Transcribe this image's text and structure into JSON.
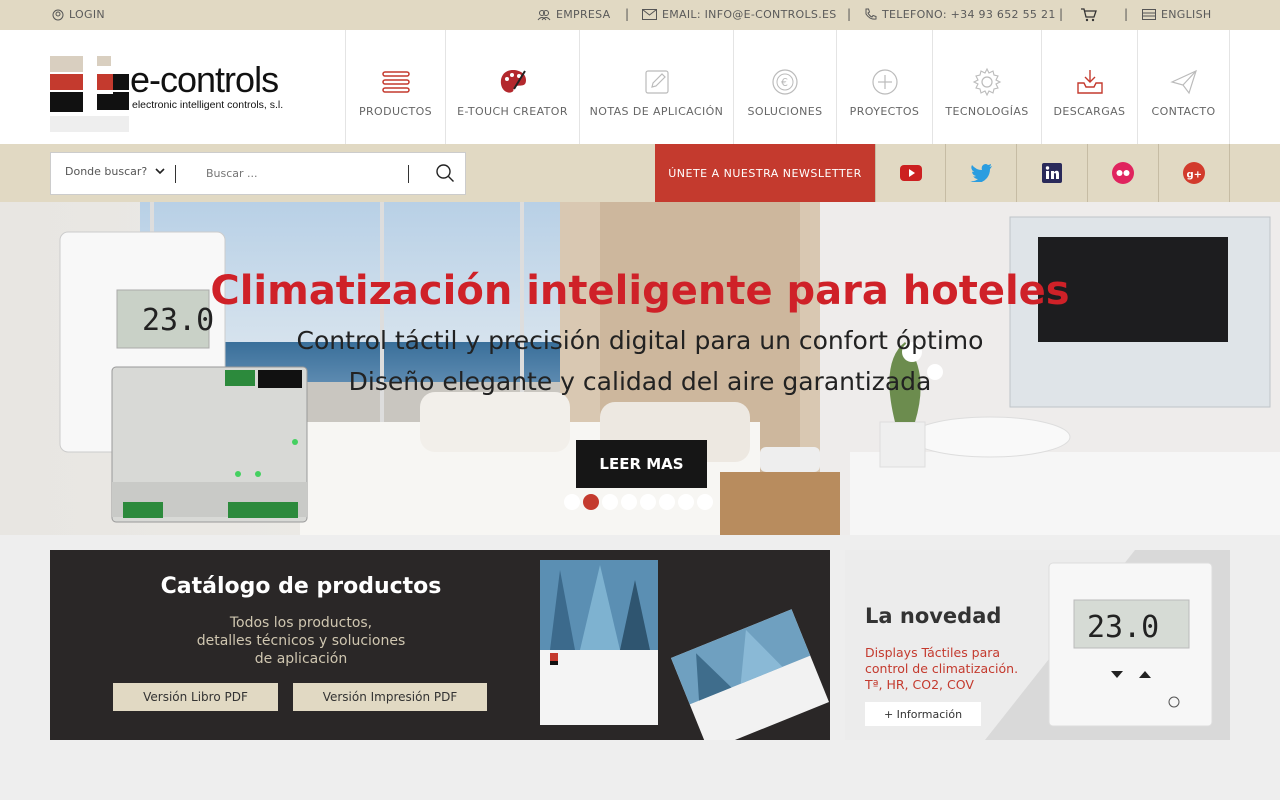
{
  "topbar": {
    "login": "LOGIN",
    "empresa": "EMPRESA",
    "email": "EMAIL: INFO@E-CONTROLS.ES",
    "telefono": "TELEFONO: +34 93 652 55 21",
    "language": "ENGLISH"
  },
  "logo": {
    "brand": "e-controls",
    "tagline": "electronic intelligent controls, s.l."
  },
  "nav": [
    {
      "label": "PRODUCTOS",
      "icon": "menu-lines-icon"
    },
    {
      "label": "E-TOUCH CREATOR",
      "icon": "palette-icon"
    },
    {
      "label": "NOTAS DE APLICACIÓN",
      "icon": "pencil-note-icon"
    },
    {
      "label": "SOLUCIONES",
      "icon": "euro-coin-icon"
    },
    {
      "label": "PROYECTOS",
      "icon": "plus-circle-icon"
    },
    {
      "label": "TECNOLOGÍAS",
      "icon": "gear-icon"
    },
    {
      "label": "DESCARGAS",
      "icon": "download-tray-icon"
    },
    {
      "label": "CONTACTO",
      "icon": "paper-plane-icon"
    }
  ],
  "search": {
    "select_value": "Donde buscar?",
    "placeholder": "Buscar ..."
  },
  "newsletter": "ÚNETE A NUESTRA NEWSLETTER",
  "hero": {
    "title": "Climatización inteligente para hoteles",
    "line1": "Control táctil y precisión digital para un confort óptimo",
    "line2": "Diseño elegante y calidad del aire garantizada",
    "button": "LEER MAS",
    "device_temp": "23.0"
  },
  "catalog": {
    "title": "Catálogo de productos",
    "desc1": "Todos los productos,",
    "desc2": "detalles técnicos y soluciones",
    "desc3": "de aplicación",
    "btn_libro": "Versión Libro PDF",
    "btn_impresion": "Versión Impresión PDF"
  },
  "novedad": {
    "title": "La novedad",
    "desc1": "Displays Táctiles para",
    "desc2": "control de climatización.",
    "desc3": "Tª, HR, CO2, COV",
    "button": "+ Información",
    "device_temp": "23.0"
  },
  "colors": {
    "accent_red": "#c43a2e",
    "beige": "#e1d9c3",
    "dark": "#2a2727"
  }
}
